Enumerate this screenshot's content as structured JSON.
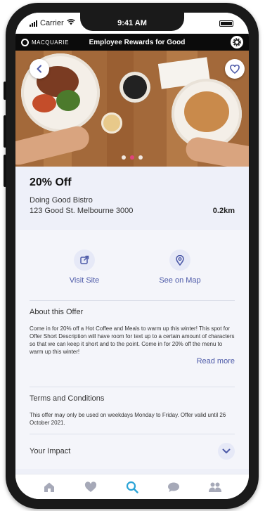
{
  "status": {
    "carrier": "Carrier",
    "time": "9:41 AM"
  },
  "appbar": {
    "brand": "MACQUARIE",
    "title": "Employee Rewards for Good"
  },
  "hero": {
    "slides": 3,
    "active_slide": 2
  },
  "offer": {
    "title": "20% Off",
    "business": "Doing Good Bistro",
    "address": "123 Good St. Melbourne 3000",
    "distance": "0.2km"
  },
  "actions": {
    "visit_site": "Visit Site",
    "see_on_map": "See on Map"
  },
  "about": {
    "title": "About this Offer",
    "body": "Come in for 20% off a Hot Coffee and Meals to warm up this winter! This spot for Offer Short Description will have room for text up to a certain amount of characters so that we can keep it short and to the point. Come in for 20% off the menu to warm up this winter!",
    "read_more": "Read more"
  },
  "terms": {
    "title": "Terms and Conditions",
    "body": "This offer may only be used on weekdays Monday to Friday. Offer valid until 26 October 2021."
  },
  "impact": {
    "title": "Your Impact"
  },
  "tabs": [
    "home-icon",
    "heart-icon",
    "search-icon",
    "chat-icon",
    "people-icon"
  ],
  "colors": {
    "accent": "#4d5aa8",
    "active_tab": "#2aa3d6",
    "dot_active": "#e0447c"
  }
}
